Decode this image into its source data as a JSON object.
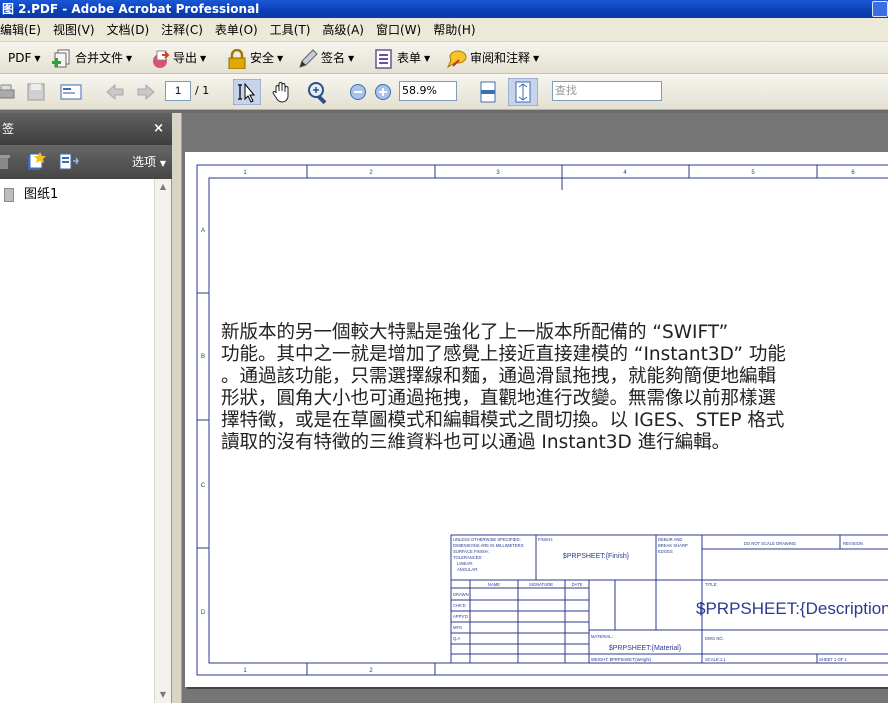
{
  "window": {
    "title": "图 2.PDF - Adobe Acrobat Professional"
  },
  "menu": [
    "编辑(E)",
    "视图(V)",
    "文档(D)",
    "注释(C)",
    "表单(O)",
    "工具(T)",
    "高级(A)",
    "窗口(W)",
    "帮助(H)"
  ],
  "toolbar": {
    "pdf": "PDF",
    "combine": "合并文件",
    "export": "导出",
    "secure": "安全",
    "sign": "签名",
    "forms": "表单",
    "review": "审阅和注释"
  },
  "nav": {
    "page": "1",
    "page_count": "/ 1",
    "zoom": "58.9%",
    "find_placeholder": "查找"
  },
  "sidebar": {
    "title": "签",
    "close": "×",
    "options": "选项",
    "bookmark": "图纸1"
  },
  "drawing": {
    "col_labels": [
      "1",
      "2",
      "3",
      "4",
      "5",
      "6"
    ],
    "row_labels": [
      "A",
      "B",
      "C",
      "D"
    ],
    "body_lines": [
      "新版本的另一個較大特點是強化了上一版本所配備的 “SWIFT”",
      "功能。其中之一就是增加了感覺上接近直接建模的 “Instant3D” 功能",
      "。通過該功能，只需選擇線和麵，通過滑鼠拖拽，就能夠簡便地編輯",
      "形狀，圓角大小也可通過拖拽，直觀地進行改變。無需像以前那樣選",
      "擇特徵，或是在草圖模式和編輯模式之間切換。以 IGES、STEP 格式",
      "讀取的沒有特徵的三維資料也可以通過 Instant3D 進行編輯。"
    ],
    "tb": {
      "unless": [
        "UNLESS OTHERWISE SPECIFIED:",
        "DIMENSIONS ARE IN MILLIMETERS",
        "SURFACE FINISH:",
        "TOLERANCES:",
        "LINEAR:",
        "ANGULAR:"
      ],
      "finish_label": "FINISH:",
      "finish_value": "$PRPSHEET:{Finish}",
      "deburr": [
        "DEBUR AND",
        "BREAK SHARP",
        "EDGES"
      ],
      "do_not_scale": "DO NOT SCALE DRAWING",
      "revision": "REVISION",
      "headers": [
        "NAME",
        "SIGNATURE",
        "DATE"
      ],
      "rows": [
        "DRAWN",
        "CHK'D",
        "APPV'D",
        "MFG",
        "Q.A"
      ],
      "title_label": "TITLE:",
      "title_value": "$PRPSHEET:{Description}",
      "material_label": "MATERIAL:",
      "material_value": "$PRPSHEET:{Material}",
      "dwg_no": "DWG NO.",
      "weight": "WEIGHT: $PRPSHEET:{Weight}",
      "scale": "SCALE:1:1",
      "sheet": "SHEET 1 OF 1"
    }
  }
}
